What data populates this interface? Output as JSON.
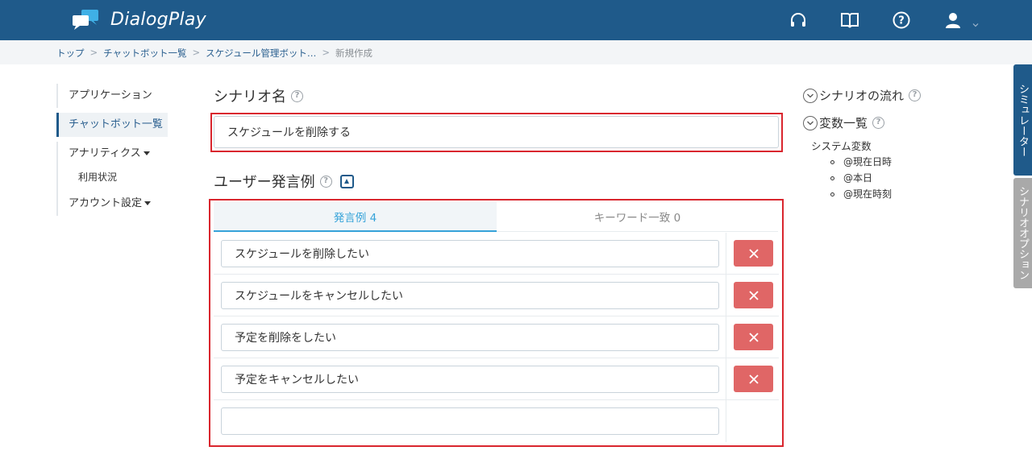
{
  "header": {
    "app_name": "DialogPlay",
    "icons": [
      "headset-icon",
      "book-icon",
      "help-icon",
      "user-icon"
    ],
    "color": "#1f5a8a"
  },
  "breadcrumb": {
    "items": [
      "トップ",
      "チャットボット一覧",
      "スケジュール管理ボット…"
    ],
    "current": "新規作成",
    "separator": ">"
  },
  "sidebar": {
    "items": [
      {
        "label": "アプリケーション"
      },
      {
        "label": "チャットボット一覧"
      },
      {
        "label": "アナリティクス"
      },
      {
        "label": "利用状況"
      },
      {
        "label": "アカウント設定"
      }
    ]
  },
  "scenario_name": {
    "title": "シナリオ名",
    "value": "スケジュールを削除する"
  },
  "utterances": {
    "title": "ユーザー発言例",
    "tabs": [
      {
        "label": "発言例 4"
      },
      {
        "label": "キーワード一致 0"
      }
    ],
    "rows": [
      {
        "value": "スケジュールを削除したい"
      },
      {
        "value": "スケジュールをキャンセルしたい"
      },
      {
        "value": "予定を削除をしたい"
      },
      {
        "value": "予定をキャンセルしたい"
      },
      {
        "value": ""
      }
    ]
  },
  "right_panel": {
    "flow_label": "シナリオの流れ",
    "vars_label": "変数一覧",
    "system_vars_label": "システム変数",
    "system_vars": [
      "@現在日時",
      "@本日",
      "@現在時刻"
    ]
  },
  "side_tabs": {
    "simulator": "シミュレーター",
    "options": "シナリオオプション"
  },
  "colors": {
    "accent": "#36a3d9",
    "highlight": "#d9262e",
    "delete": "#e06666"
  }
}
